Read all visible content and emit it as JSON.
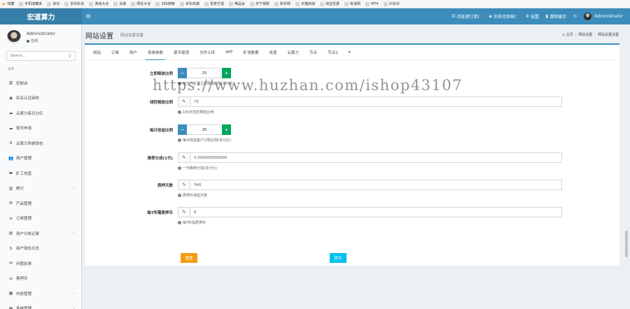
{
  "bookmarks": [
    {
      "label": "收藏",
      "icon": "star-icon"
    },
    {
      "label": "手机收藏夹",
      "icon": "folder-icon"
    },
    {
      "label": "京东",
      "icon": "page-icon"
    },
    {
      "label": "京东秒杀",
      "icon": "page-icon"
    },
    {
      "label": "游戏大全",
      "icon": "page-icon"
    },
    {
      "label": "谷歌",
      "icon": "page-icon"
    },
    {
      "label": "网址大全",
      "icon": "page-icon"
    },
    {
      "label": "360搜索",
      "icon": "page-icon"
    },
    {
      "label": "京东商城",
      "icon": "page-icon"
    },
    {
      "label": "爱奇艺视",
      "icon": "page-icon"
    },
    {
      "label": "唯品会",
      "icon": "page-icon"
    },
    {
      "label": "苏宁易购",
      "icon": "page-icon"
    },
    {
      "label": "知乎网",
      "icon": "page-icon"
    },
    {
      "label": "天猫商城",
      "icon": "page-icon"
    },
    {
      "label": "淘宝优惠",
      "icon": "page-icon"
    },
    {
      "label": "有道网",
      "icon": "page-icon"
    },
    {
      "label": "MT4",
      "icon": "page-icon"
    },
    {
      "label": "计划书",
      "icon": "page-icon"
    }
  ],
  "topnav": {
    "logo": "宏道算力",
    "hamburger": "≡",
    "items": [
      {
        "label": "待处理订单(",
        "badge": "",
        "icon": "list-icon"
      },
      {
        "label": "实名待审核(",
        "badge": "",
        "icon": "shield-icon"
      },
      {
        "label": "设置",
        "icon": "gear-icon"
      },
      {
        "label": "清除缓存",
        "icon": "trash-icon"
      }
    ],
    "refresh_icon": "↻",
    "user": "Administrator"
  },
  "sidebar": {
    "user_name": "Administrator",
    "status": "在线",
    "search_placeholder": "Search...",
    "header": "菜单",
    "items": [
      {
        "label": "控制台",
        "icon": "▥",
        "chevron": false
      },
      {
        "label": "实名认证审核",
        "icon": "◉",
        "chevron": false
      },
      {
        "label": "云算力每日分红",
        "icon": "☁",
        "chevron": false
      },
      {
        "label": "提币申请",
        "icon": "☁",
        "chevron": false
      },
      {
        "label": "云算力系统钱包",
        "icon": "$",
        "chevron": false
      },
      {
        "label": "用户管理",
        "icon": "👥",
        "chevron": false
      },
      {
        "label": "矿工充值",
        "icon": "▬",
        "chevron": false
      },
      {
        "label": "统计",
        "icon": "▥",
        "chevron": true
      },
      {
        "label": "产品管理",
        "icon": "⚙",
        "chevron": false
      },
      {
        "label": "订单管理",
        "icon": "≡",
        "chevron": false
      },
      {
        "label": "用户分成记录",
        "icon": "▤",
        "chevron": true
      },
      {
        "label": "用户钱包日志",
        "icon": "$",
        "chevron": false
      },
      {
        "label": "问题反馈",
        "icon": "✉",
        "chevron": false
      },
      {
        "label": "客押币",
        "icon": "≡",
        "chevron": false
      },
      {
        "label": "内容管理",
        "icon": "▦",
        "chevron": true
      },
      {
        "label": "系统管理",
        "icon": "▦",
        "chevron": true
      }
    ]
  },
  "page": {
    "title": "网站设置",
    "subtitle": "网站设置设置",
    "breadcrumb": [
      "主页",
      "网站设置",
      "网站设置设置"
    ]
  },
  "tabs": [
    "网站",
    "订单",
    "用户",
    "系统参数",
    "提币提现",
    "文件上传",
    "APP",
    "矿池数据",
    "充值",
    "云算力",
    "节点",
    "节点2",
    "▾"
  ],
  "fields": {
    "f1": {
      "label": "立即释放比例",
      "value": "25",
      "help": "每日产生量立即释放比例(百分比)"
    },
    "f2": {
      "label": "线性释放比例",
      "value": "75",
      "help": "180天线性释放比例"
    },
    "f3": {
      "label": "每日收益比例",
      "value": "36",
      "help": "每日收益客户分配比例(百分比)"
    },
    "f4": {
      "label": "推荐分成(1代)",
      "value": "0.000000000000",
      "help": "一代推荐分成(百分比)"
    },
    "f5": {
      "label": "质押天数",
      "value": "540",
      "help": "质押币保留天数"
    },
    "f6": {
      "label": "每T所需质押币",
      "value": "6",
      "help": "每T所需质押币"
    }
  },
  "buttons": {
    "reset": "重置",
    "submit": "提交"
  },
  "watermark": "https://www.huzhan.com/ishop43107",
  "colors": {
    "primary": "#3c8dbc",
    "logo_bg": "#367fa9",
    "success": "#00a65a",
    "warning": "#f39c12",
    "info": "#00c0ef"
  }
}
